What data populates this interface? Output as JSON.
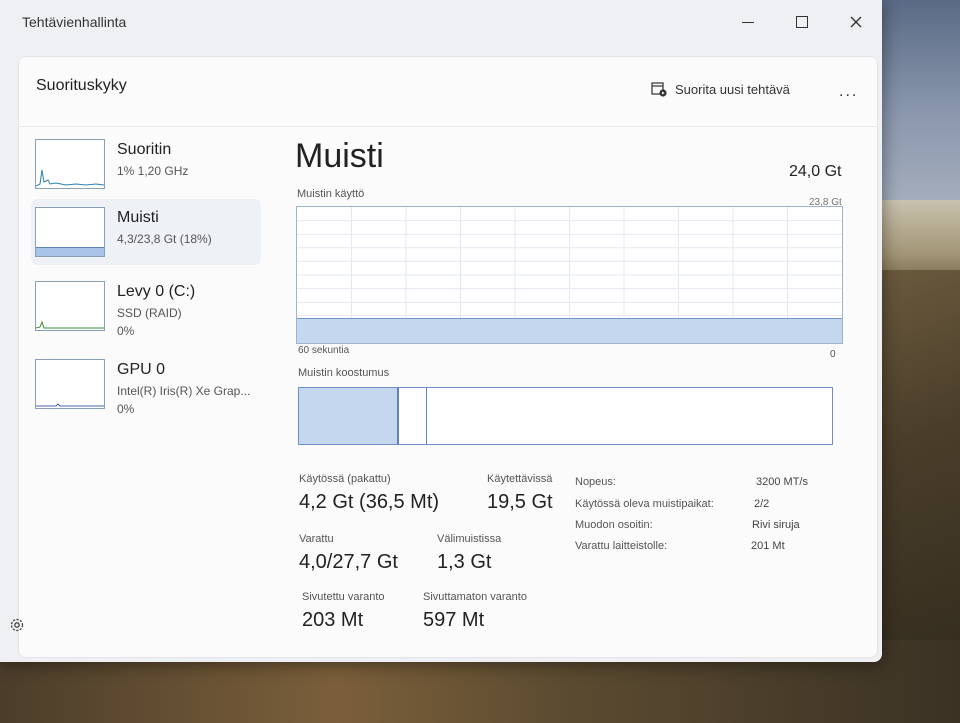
{
  "window": {
    "title": "Tehtävienhallinta"
  },
  "header": {
    "page_title": "Suorituskyky",
    "run_task_label": "Suorita uusi tehtävä",
    "more_label": "..."
  },
  "sidebar": {
    "items": [
      {
        "name": "Suoritin",
        "sub": "1% 1,20 GHz",
        "sub2": ""
      },
      {
        "name": "Muisti",
        "sub": "4,3/23,8 Gt (18%)",
        "sub2": ""
      },
      {
        "name": "Levy 0 (C:)",
        "sub": "SSD (RAID)",
        "sub2": "0%"
      },
      {
        "name": "GPU 0",
        "sub": "Intel(R) Iris(R) Xe Grap...",
        "sub2": "0%"
      }
    ]
  },
  "memory": {
    "title": "Muisti",
    "total": "24,0 Gt",
    "usage_label": "Muistin käyttö",
    "usage_max": "23,8 Gt",
    "usage_fraction": 0.18,
    "time_label": "60 sekuntia",
    "zero_label": "0",
    "composition_label": "Muistin koostumus",
    "stats": {
      "in_use_label": "Käytössä (pakattu)",
      "in_use_value": "4,2 Gt (36,5 Mt)",
      "available_label": "Käytettävissä",
      "available_value": "19,5 Gt",
      "committed_label": "Varattu",
      "committed_value": "4,0/27,7 Gt",
      "cached_label": "Välimuistissa",
      "cached_value": "1,3 Gt",
      "paged_label": "Sivutettu varanto",
      "paged_value": "203 Mt",
      "nonpaged_label": "Sivuttamaton varanto",
      "nonpaged_value": "597 Mt"
    },
    "details": [
      {
        "label": "Nopeus:",
        "value": "3200 MT/s"
      },
      {
        "label": "Käytössä oleva muistipaikat:",
        "value": "2/2"
      },
      {
        "label": "Muodon osoitin:",
        "value": "Rivi siruja"
      },
      {
        "label": "Varattu laitteistolle:",
        "value": "201 Mt"
      }
    ]
  },
  "colors": {
    "graph_fill": "#c5d7ee",
    "graph_line": "#6f97c9",
    "border": "#9fb4cc"
  }
}
